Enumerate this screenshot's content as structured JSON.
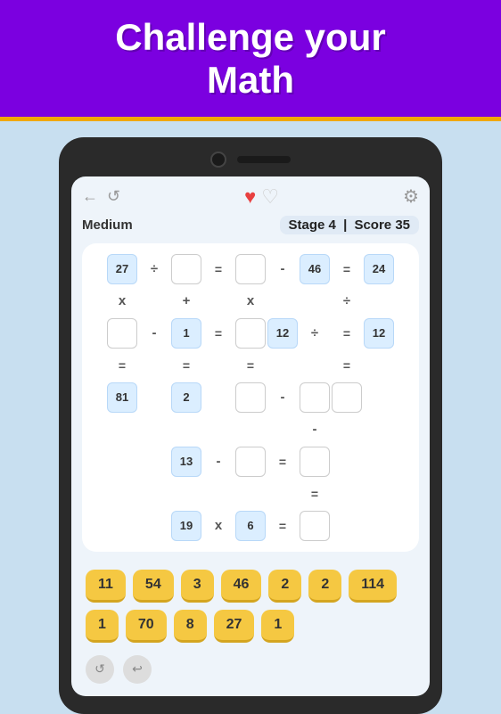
{
  "header": {
    "title_line1": "Challenge your",
    "title_line2": "Math"
  },
  "nav": {
    "back_icon": "←",
    "refresh_icon": "↺",
    "heart_full": "♥",
    "heart_empty": "♡",
    "gear_icon": "⚙"
  },
  "info": {
    "difficulty": "Medium",
    "stage_label": "Stage",
    "stage_value": "4",
    "score_label": "Score",
    "score_value": "35"
  },
  "answer_tiles": [
    "11",
    "54",
    "3",
    "46",
    "2",
    "2",
    "114",
    "1",
    "70",
    "8",
    "27",
    "1"
  ],
  "bottom_icons": [
    "↺",
    "↩"
  ]
}
